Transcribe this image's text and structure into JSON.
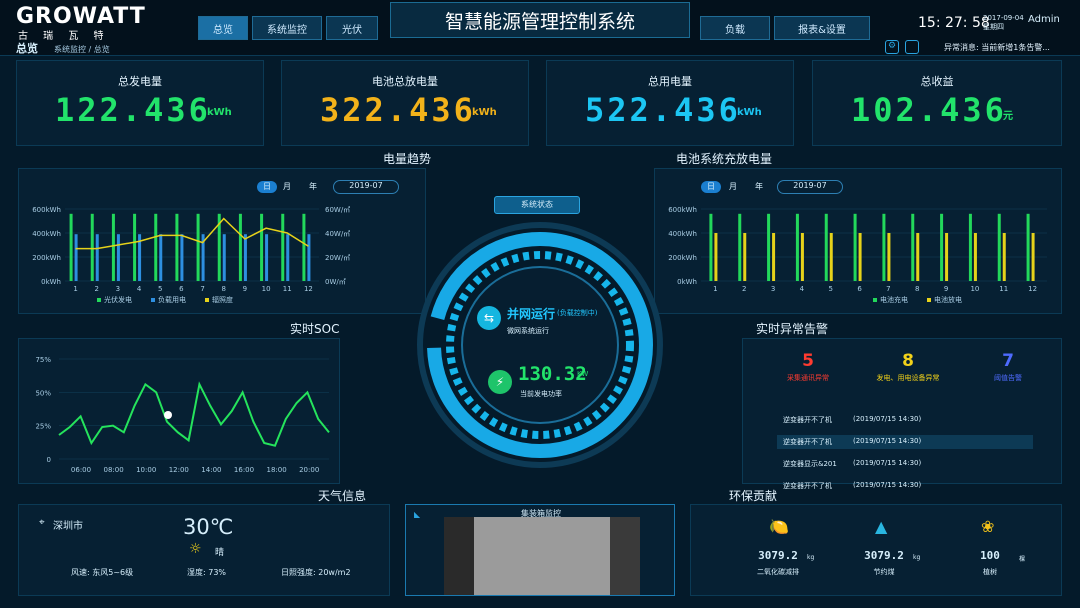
{
  "brand": {
    "name": "GROWATT",
    "cn": "古 瑞 瓦 特"
  },
  "page_title": "总览",
  "breadcrumb": "系统监控 / 总览",
  "system_title": "智慧能源管理控制系统",
  "nav": {
    "left": [
      "总览",
      "系统监控",
      "光伏"
    ],
    "right": [
      "负载",
      "报表&设置"
    ]
  },
  "clock": {
    "time": "15: 27: 58",
    "date": "2017-09-04",
    "weekday": "星期四"
  },
  "user": "Admin",
  "alert_bar": "异常消息: 当前新增1条告警...",
  "kpis": [
    {
      "label": "总发电量",
      "value": "122.436",
      "unit": "kWh",
      "color": "#22e36b"
    },
    {
      "label": "电池总放电量",
      "value": "322.436",
      "unit": "kWh",
      "color": "#f2b21a"
    },
    {
      "label": "总用电量",
      "value": "522.436",
      "unit": "kWh",
      "color": "#1cc6f3"
    },
    {
      "label": "总收益",
      "value": "102.436",
      "unit": "元",
      "color": "#22e36b"
    }
  ],
  "trend": {
    "title": "电量趋势",
    "tabs": [
      "日",
      "月",
      "年"
    ],
    "date": "2019-07"
  },
  "battery": {
    "title": "电池系统充放电量",
    "tabs": [
      "日",
      "月",
      "年"
    ],
    "date": "2019-07"
  },
  "center": {
    "status_button": "系统状态",
    "grid_status": "并网运行",
    "grid_mode": "(负载控制中)",
    "grid_sub": "微网系统运行",
    "power": "130.32",
    "power_unit": "KW",
    "power_label": "当前发电功率"
  },
  "soc": {
    "title": "实时SOC"
  },
  "alarm": {
    "title": "实时异常告警",
    "counts": [
      {
        "value": "5",
        "label": "采集通讯异常",
        "color": "#ff3b30"
      },
      {
        "value": "8",
        "label": "发电、用电设备异常",
        "color": "#f2d21a"
      },
      {
        "value": "7",
        "label": "阈值告警",
        "color": "#4e6bff"
      }
    ],
    "items": [
      {
        "text": "逆变器开不了机",
        "time": "(2019/07/15 14:30)"
      },
      {
        "text": "逆变器开不了机",
        "time": "(2019/07/15 14:30)"
      },
      {
        "text": "逆变器显示&201",
        "time": "(2019/07/15 14:30)"
      },
      {
        "text": "逆变器开不了机",
        "time": "(2019/07/15 14:30)"
      }
    ]
  },
  "weather": {
    "title": "天气信息",
    "city": "深圳市",
    "temp": "30℃",
    "cond": "晴",
    "wind": "风速: 东风5~6级",
    "humidity": "湿度: 73%",
    "sun": "日照强度: 20w/m2"
  },
  "camera": {
    "title": "集装箱监控"
  },
  "eco": {
    "title": "环保贡献",
    "items": [
      {
        "value": "3079.2",
        "unit": "kg",
        "label": "二氧化碳减排"
      },
      {
        "value": "3079.2",
        "unit": "kg",
        "label": "节约煤"
      },
      {
        "value": "100",
        "unit": "棵",
        "label": "植树"
      }
    ]
  },
  "chart_data": [
    {
      "type": "bar",
      "title": "电量趋势",
      "categories": [
        "1",
        "2",
        "3",
        "4",
        "5",
        "6",
        "7",
        "8",
        "9",
        "10",
        "11",
        "12"
      ],
      "ylim": [
        0,
        600000
      ],
      "yticks": [
        "0kWh",
        "200kWh",
        "400kWh",
        "600kWh"
      ],
      "y2ticks": [
        "0W/㎡",
        "20W/㎡",
        "40W/㎡",
        "60W/㎡"
      ],
      "series": [
        {
          "name": "光伏发电",
          "color": "#22d85b",
          "values": [
            560000,
            560000,
            560000,
            560000,
            560000,
            560000,
            560000,
            560000,
            560000,
            560000,
            560000,
            560000
          ]
        },
        {
          "name": "负载用电",
          "color": "#2d8fe0",
          "values": [
            390000,
            390000,
            390000,
            390000,
            390000,
            390000,
            390000,
            390000,
            390000,
            390000,
            390000,
            390000
          ]
        },
        {
          "name": "辐照度",
          "type": "line",
          "color": "#e6d21a",
          "values": [
            27,
            27,
            30,
            33,
            38,
            38,
            32,
            52,
            35,
            44,
            40,
            29
          ]
        }
      ]
    },
    {
      "type": "bar",
      "title": "电池系统充放电量",
      "categories": [
        "1",
        "2",
        "3",
        "4",
        "5",
        "6",
        "7",
        "8",
        "9",
        "10",
        "11",
        "12"
      ],
      "ylim": [
        0,
        600000
      ],
      "yticks": [
        "0kWh",
        "200kWh",
        "400kWh",
        "600kWh"
      ],
      "series": [
        {
          "name": "电池充电",
          "color": "#22d85b",
          "values": [
            560000,
            560000,
            560000,
            560000,
            560000,
            560000,
            560000,
            560000,
            560000,
            560000,
            560000,
            560000
          ]
        },
        {
          "name": "电池放电",
          "color": "#e6d21a",
          "values": [
            400000,
            400000,
            400000,
            400000,
            400000,
            400000,
            400000,
            400000,
            400000,
            400000,
            400000,
            400000
          ]
        }
      ]
    },
    {
      "type": "line",
      "title": "实时SOC",
      "x": [
        "06:00",
        "08:00",
        "10:00",
        "12:00",
        "14:00",
        "16:00",
        "18:00",
        "20:00"
      ],
      "yticks": [
        "0",
        "25%",
        "50%",
        "75%"
      ],
      "ylim": [
        0,
        75
      ],
      "series": [
        {
          "values": [
            18,
            24,
            32,
            12,
            24,
            25,
            20,
            40,
            56,
            50,
            28,
            20,
            14,
            56,
            40,
            26,
            36,
            50,
            28,
            12,
            10,
            30,
            42,
            50,
            30,
            20
          ]
        }
      ]
    }
  ]
}
